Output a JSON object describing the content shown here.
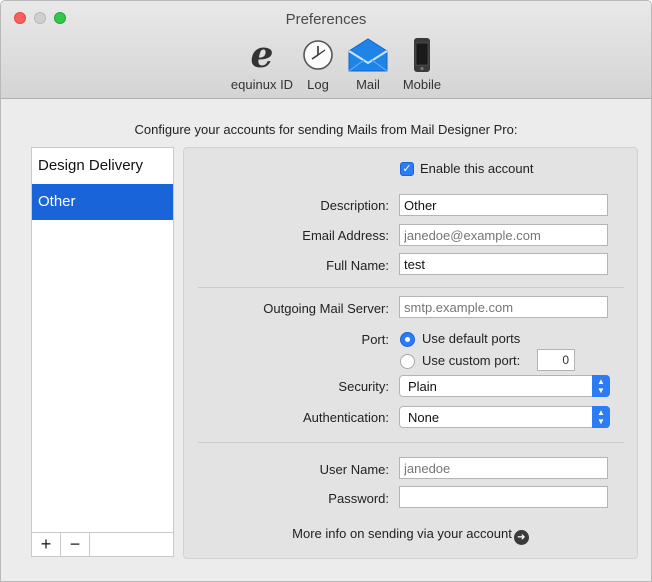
{
  "window": {
    "title": "Preferences"
  },
  "toolbar": {
    "items": [
      {
        "label": "equinux ID",
        "icon": "equinux-e-icon"
      },
      {
        "label": "Log",
        "icon": "clock-icon"
      },
      {
        "label": "Mail",
        "icon": "mail-envelope-icon",
        "selected": true
      },
      {
        "label": "Mobile",
        "icon": "iphone-icon"
      }
    ]
  },
  "intro": "Configure your accounts for sending Mails from Mail Designer Pro:",
  "accounts": {
    "items": [
      {
        "label": "Design Delivery",
        "selected": false
      },
      {
        "label": "Other",
        "selected": true
      }
    ],
    "add_label": "+",
    "remove_label": "−"
  },
  "form": {
    "enable_label": "Enable this account",
    "enable_checked": true,
    "description_label": "Description:",
    "description_value": "Other",
    "email_label": "Email Address:",
    "email_placeholder": "janedoe@example.com",
    "fullname_label": "Full Name:",
    "fullname_value": "test",
    "server_label": "Outgoing Mail Server:",
    "server_placeholder": "smtp.example.com",
    "port_label": "Port:",
    "port_default_label": "Use default ports",
    "port_custom_label": "Use custom port:",
    "port_custom_value": "0",
    "security_label": "Security:",
    "security_value": "Plain",
    "auth_label": "Authentication:",
    "auth_value": "None",
    "username_label": "User Name:",
    "username_placeholder": "janedoe",
    "password_label": "Password:",
    "password_value": "",
    "more_info": "More info on sending via your account"
  },
  "colors": {
    "accent": "#2b7cf5",
    "selection": "#1a64d9"
  }
}
